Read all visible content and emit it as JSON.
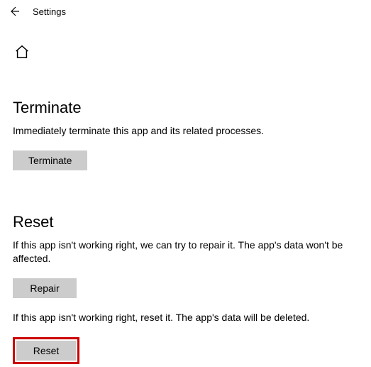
{
  "header": {
    "title": "Settings"
  },
  "terminate": {
    "heading": "Terminate",
    "desc": "Immediately terminate this app and its related processes.",
    "button": "Terminate"
  },
  "reset": {
    "heading": "Reset",
    "repair_desc": "If this app isn't working right, we can try to repair it. The app's data won't be affected.",
    "repair_button": "Repair",
    "reset_desc": "If this app isn't working right, reset it. The app's data will be deleted.",
    "reset_button": "Reset"
  }
}
